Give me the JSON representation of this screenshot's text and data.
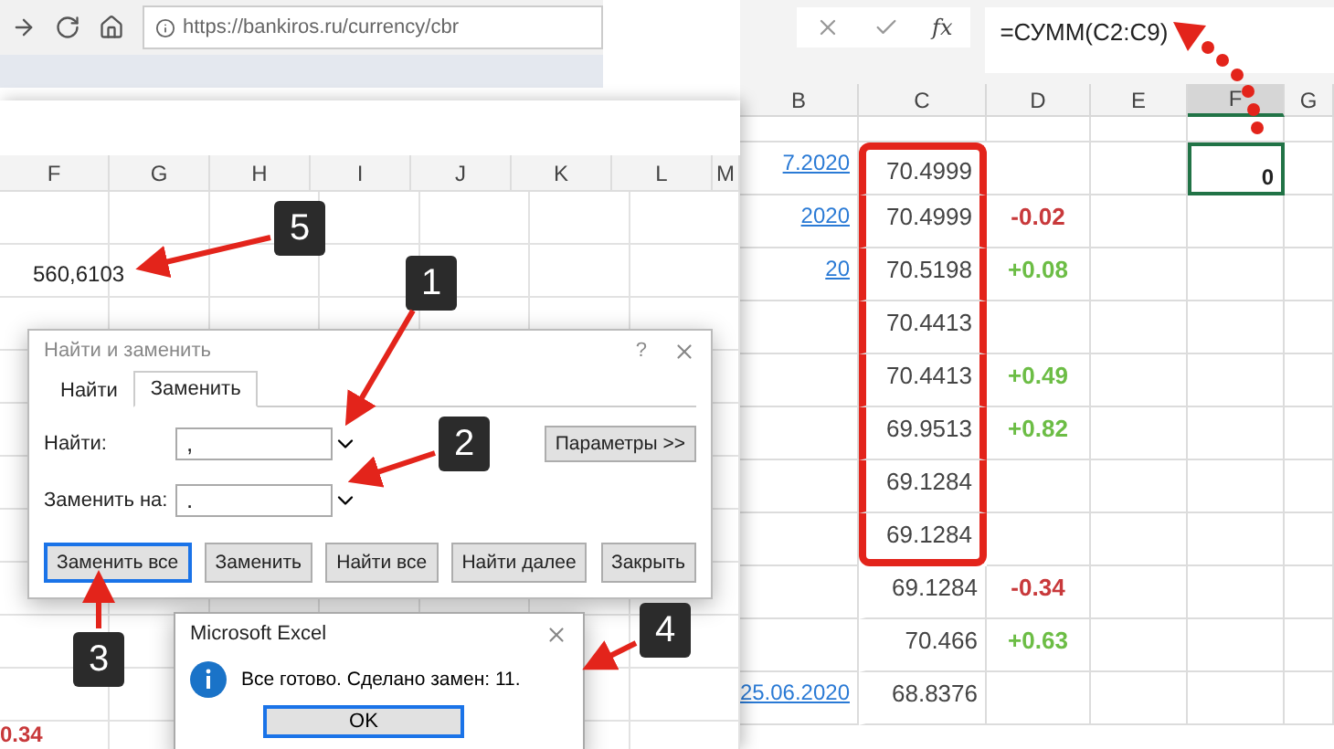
{
  "browser": {
    "url": "https://bankiros.ru/currency/cbr"
  },
  "back_sheet": {
    "columns": [
      "F",
      "G",
      "H",
      "I",
      "J",
      "K",
      "L",
      "M"
    ],
    "cell": "560,6103"
  },
  "callouts": [
    "1",
    "2",
    "3",
    "4",
    "5"
  ],
  "find_replace": {
    "title": "Найти и заменить",
    "help": "?",
    "tabs": [
      {
        "label": "Найти",
        "selected": false
      },
      {
        "label": "Заменить",
        "selected": true
      }
    ],
    "fields": [
      {
        "label": "Найти:",
        "value": ","
      },
      {
        "label": "Заменить на:",
        "value": "."
      }
    ],
    "options_button": "Параметры >>",
    "buttons": [
      {
        "label": "Заменить все",
        "selected": true
      },
      {
        "label": "Заменить",
        "selected": false
      },
      {
        "label": "Найти все",
        "selected": false
      },
      {
        "label": "Найти далее",
        "selected": false
      },
      {
        "label": "Закрыть",
        "selected": false
      }
    ]
  },
  "message_box": {
    "title": "Microsoft Excel",
    "text": "Все готово. Сделано замен: 11.",
    "button": "OK"
  },
  "corner_value": "0.34",
  "formula_bar": {
    "function_label": "fx",
    "formula": "=СУММ(C2:C9)"
  },
  "sheet": {
    "columns": [
      {
        "label": "B",
        "selected": false
      },
      {
        "label": "C",
        "selected": false
      },
      {
        "label": "D",
        "selected": false
      },
      {
        "label": "E",
        "selected": false
      },
      {
        "label": "F",
        "selected": true
      },
      {
        "label": "G",
        "selected": false
      }
    ],
    "selected_cell": "0",
    "rows": [
      {
        "date": "7.2020",
        "rate": "70.4999",
        "highlighted": true
      },
      {
        "date": "2020",
        "rate": "70.4999",
        "change": "-0.02",
        "color": "#c8393b",
        "highlighted": true
      },
      {
        "date": "20",
        "rate": "70.5198",
        "change": "+0.08",
        "color": "#6cbd45",
        "highlighted": true
      },
      {
        "rate": "70.4413",
        "highlighted": true
      },
      {
        "rate": "70.4413",
        "change": "+0.49",
        "color": "#6cbd45",
        "highlighted": true
      },
      {
        "rate": "69.9513",
        "change": "+0.82",
        "color": "#6cbd45",
        "highlighted": true
      },
      {
        "rate": "69.1284",
        "highlighted": true
      },
      {
        "rate": "69.1284",
        "highlighted": true
      },
      {
        "rate": "69.1284",
        "change": "-0.34",
        "color": "#c8393b",
        "highlighted": false
      },
      {
        "rate": "70.466",
        "change": "+0.63",
        "color": "#6cbd45",
        "highlighted": false
      },
      {
        "date": "25.06.2020",
        "rate": "68.8376",
        "highlighted": false
      }
    ]
  }
}
